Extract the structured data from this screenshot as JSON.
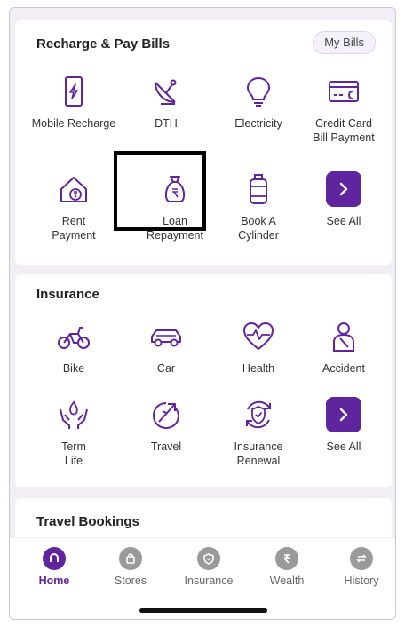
{
  "recharge": {
    "title": "Recharge & Pay Bills",
    "my_bills": "My Bills",
    "items": [
      {
        "label": "Mobile Recharge",
        "icon": "mobile-recharge-icon"
      },
      {
        "label": "DTH",
        "icon": "satellite-dish-icon"
      },
      {
        "label": "Electricity",
        "icon": "bulb-icon"
      },
      {
        "label": "Credit Card\nBill Payment",
        "icon": "credit-card-icon"
      },
      {
        "label": "Rent\nPayment",
        "icon": "house-rupee-icon"
      },
      {
        "label": "Loan\nRepayment",
        "icon": "money-bag-icon"
      },
      {
        "label": "Book A\nCylinder",
        "icon": "cylinder-icon"
      },
      {
        "label": "See All",
        "icon": "chevron-right-icon"
      }
    ]
  },
  "insurance": {
    "title": "Insurance",
    "items": [
      {
        "label": "Bike",
        "icon": "bike-icon"
      },
      {
        "label": "Car",
        "icon": "car-icon"
      },
      {
        "label": "Health",
        "icon": "heart-pulse-icon"
      },
      {
        "label": "Accident",
        "icon": "accident-person-icon"
      },
      {
        "label": "Term\nLife",
        "icon": "hands-flame-icon"
      },
      {
        "label": "Travel",
        "icon": "plane-globe-icon"
      },
      {
        "label": "Insurance\nRenewal",
        "icon": "shield-renewal-icon"
      },
      {
        "label": "See All",
        "icon": "chevron-right-icon"
      }
    ]
  },
  "travel": {
    "title": "Travel Bookings"
  },
  "nav": [
    {
      "label": "Home",
      "icon": "home-icon",
      "active": true
    },
    {
      "label": "Stores",
      "icon": "bag-icon",
      "active": false
    },
    {
      "label": "Insurance",
      "icon": "shield-icon",
      "active": false
    },
    {
      "label": "Wealth",
      "icon": "rupee-icon",
      "active": false
    },
    {
      "label": "History",
      "icon": "arrows-icon",
      "active": false
    }
  ],
  "colors": {
    "brand": "#5f259f",
    "icon_stroke": "#5f259f",
    "nav_inactive": "#9a9a9a"
  }
}
